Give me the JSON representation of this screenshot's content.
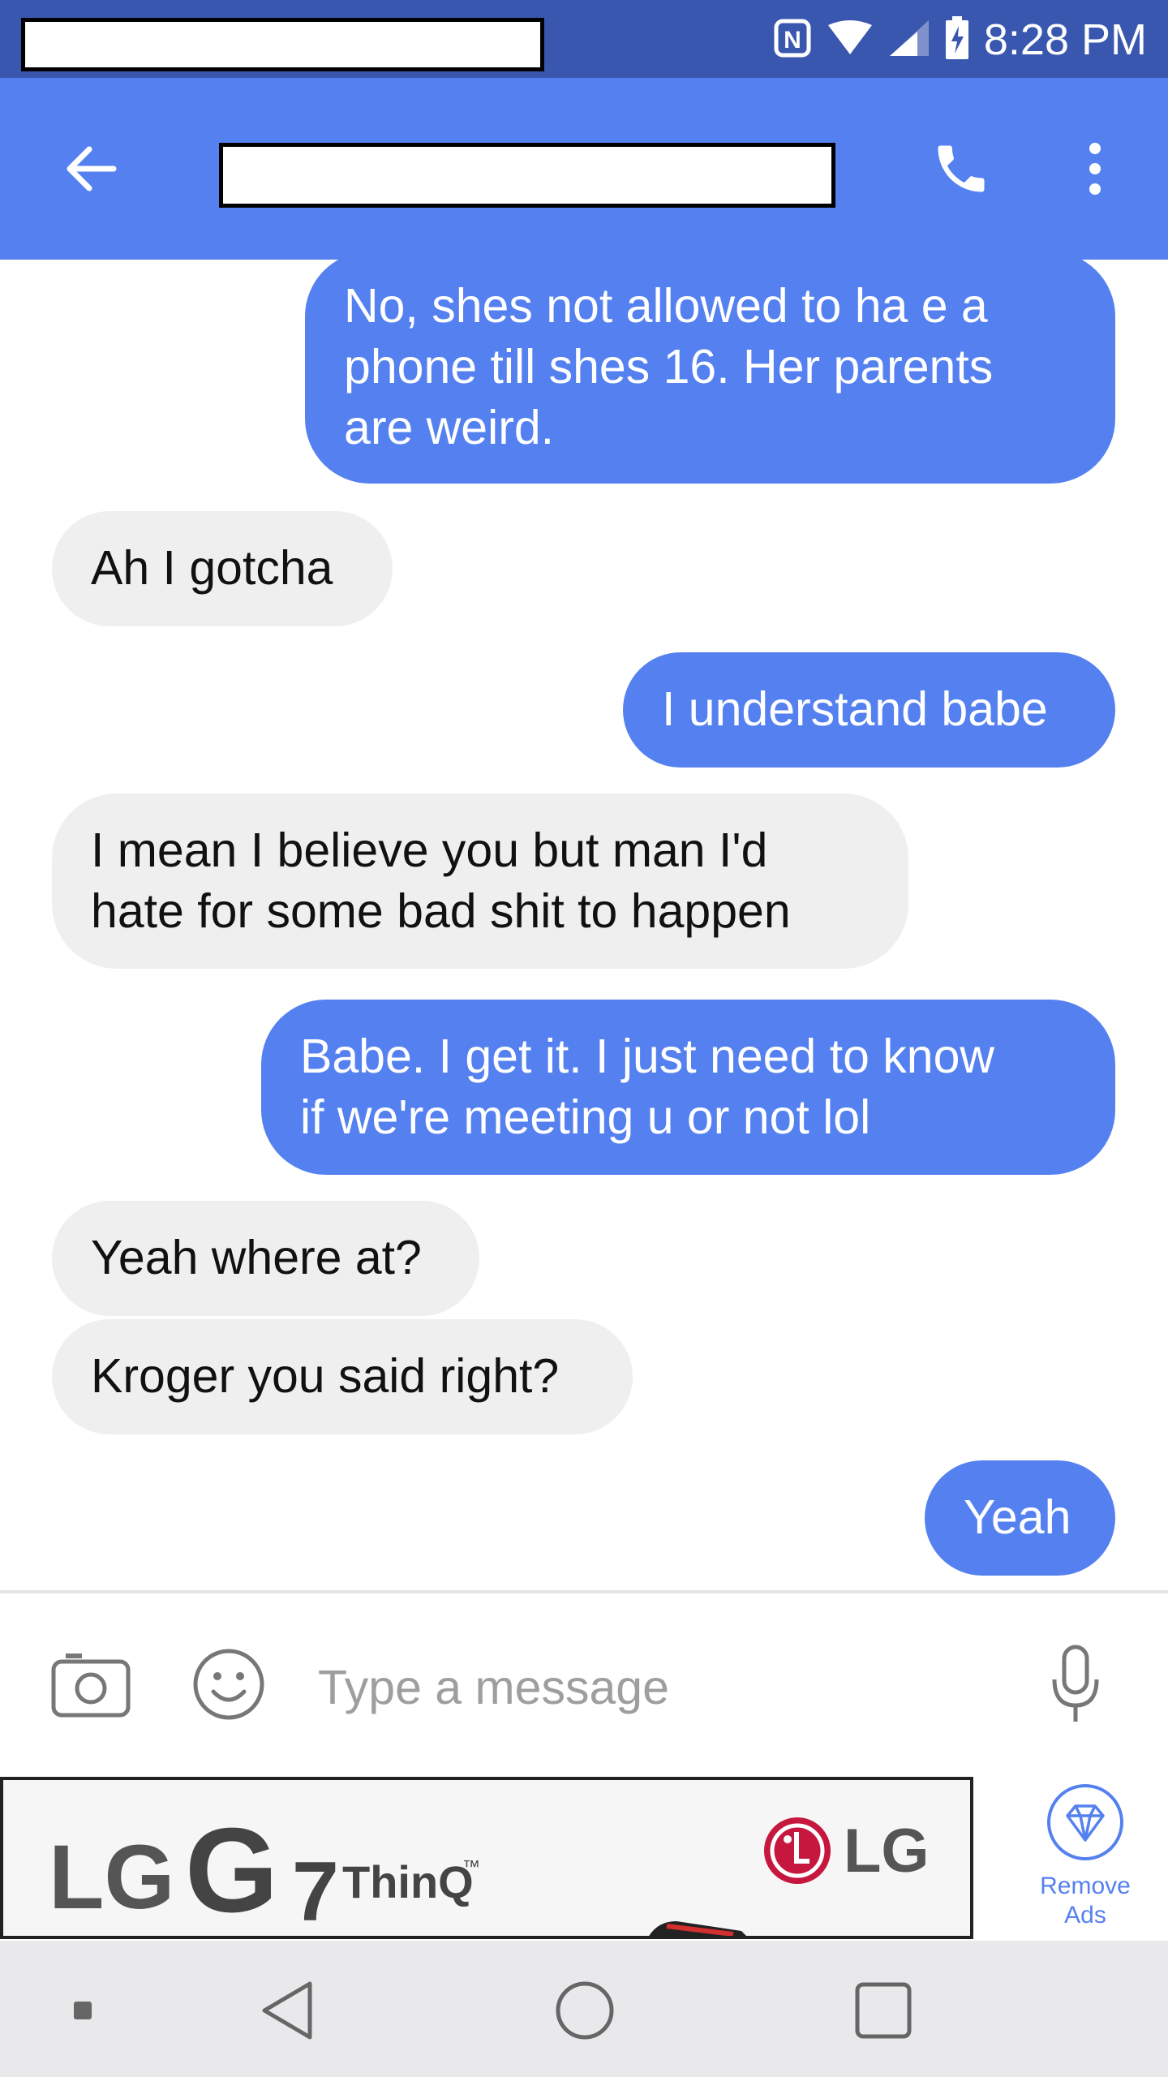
{
  "status_bar": {
    "time": "8:28 PM",
    "icons": [
      "nfc-icon",
      "wifi-icon",
      "signal-icon",
      "battery-charging-icon"
    ]
  },
  "app_bar": {
    "icons": [
      "back-arrow-icon",
      "phone-icon",
      "more-vert-icon"
    ]
  },
  "messages": [
    {
      "direction": "outgoing",
      "text": "No, shes not allowed to ha e a\nphone till shes 16. Her parents\nare weird."
    },
    {
      "direction": "incoming",
      "text": "Ah I gotcha"
    },
    {
      "direction": "outgoing",
      "text": "I understand babe"
    },
    {
      "direction": "incoming",
      "text": "I mean I believe you but man I'd\nhate for some bad shit to happen"
    },
    {
      "direction": "outgoing",
      "text": "Babe. I get it. I just need to know\nif we're meeting u or not lol"
    },
    {
      "direction": "incoming",
      "text": "Yeah where at?"
    },
    {
      "direction": "incoming",
      "text": "Kroger you said right?"
    },
    {
      "direction": "outgoing",
      "text": "Yeah"
    }
  ],
  "composer": {
    "placeholder": "Type a message",
    "icons": [
      "camera-icon",
      "emoji-icon",
      "microphone-icon"
    ]
  },
  "ad": {
    "brand": "LG",
    "product": "G",
    "model_number": "7",
    "product_suffix": "ThinQ",
    "trademark": "™",
    "logo_text": "LG"
  },
  "remove_ads": {
    "line1": "Remove",
    "line2": "Ads"
  },
  "colors": {
    "status_bar": "#3a57b0",
    "app_bar": "#5581f0",
    "outgoing_bubble": "#5581f0",
    "incoming_bubble": "#efefef",
    "lg_red": "#c6173f"
  }
}
